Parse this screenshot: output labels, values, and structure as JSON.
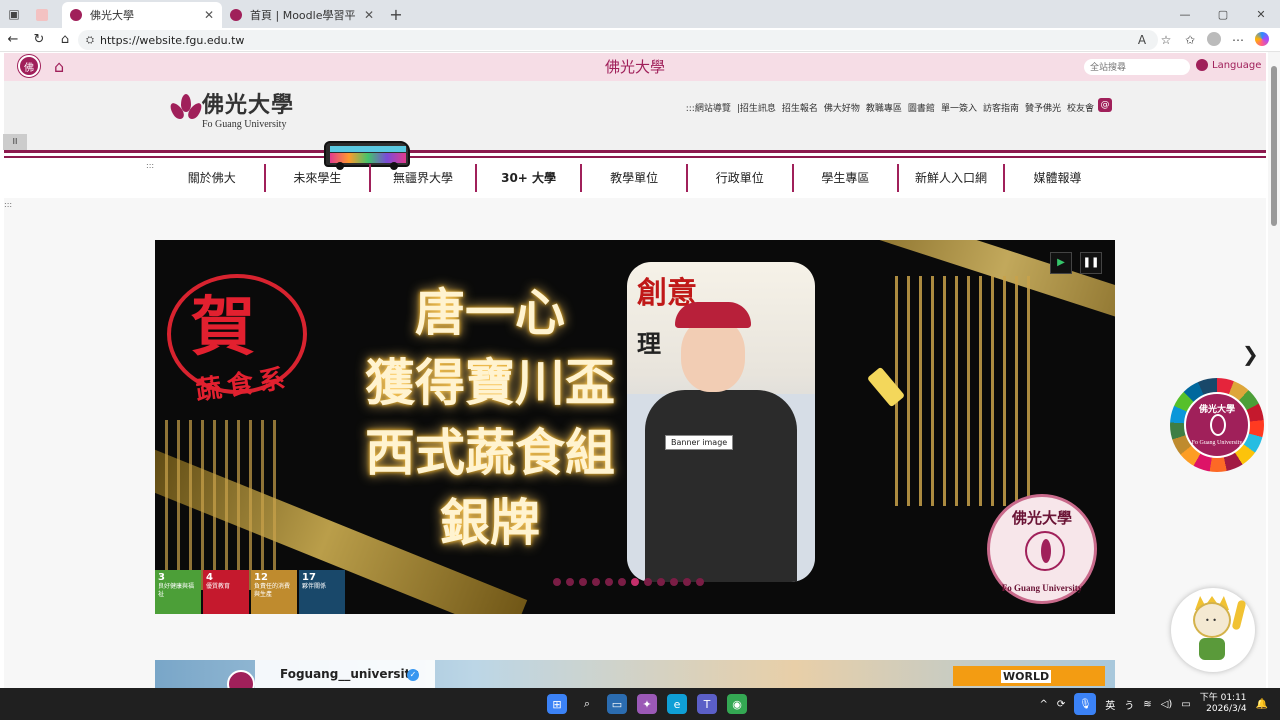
{
  "browser": {
    "tabs": [
      {
        "label": "",
        "favicon": "pdf-icon",
        "active": false
      },
      {
        "label": "佛光大學",
        "favicon": "fgu-logo-icon",
        "active": true
      },
      {
        "label": "首頁 | Moodle學習平臺",
        "favicon": "moodle-icon",
        "active": false
      }
    ],
    "new_tab_glyph": "+",
    "url": "https://website.fgu.edu.tw",
    "window_controls": [
      "—",
      "▢",
      "✕"
    ]
  },
  "topbar": {
    "site_title": "佛光大學",
    "search_placeholder": "全站搜尋",
    "language_label": "Language"
  },
  "header": {
    "brand_zh": "佛光大學",
    "brand_en": "Fo Guang University",
    "quick_links": [
      ":::網站導覽",
      "|招生訊息",
      "招生報名",
      "佛大好物",
      "教職專區",
      "圖書館",
      "單一簽入",
      "訪客指南",
      "贊予佛光",
      "校友會"
    ],
    "pause_label": "II",
    "accent_color": "#a0205a"
  },
  "main_nav": [
    {
      "label": "關於佛大",
      "bold": false
    },
    {
      "label": "未來學生",
      "bold": false
    },
    {
      "label": "無疆界大學",
      "bold": false
    },
    {
      "label": "30+ 大學",
      "bold": true
    },
    {
      "label": "教學單位",
      "bold": false
    },
    {
      "label": "行政單位",
      "bold": false
    },
    {
      "label": "學生專區",
      "bold": false
    },
    {
      "label": "新鮮人入口網",
      "bold": false
    },
    {
      "label": "媒體報導",
      "bold": false
    }
  ],
  "banner": {
    "stamp_main": "賀",
    "stamp_sub": "蔬食系",
    "headline_lines": [
      "唐一心",
      "獲得寶川盃",
      "西式蔬食組",
      "銀牌"
    ],
    "photo_sign_1": "創意",
    "photo_sign_2": "理",
    "tooltip": "Banner image",
    "seal_zh": "佛光大學",
    "seal_en": "Fo Guang University",
    "sdg_tiles": [
      {
        "number": "3",
        "label": "良好健康與福祉",
        "color": "#4c9f38"
      },
      {
        "number": "4",
        "label": "優質教育",
        "color": "#c5192d"
      },
      {
        "number": "12",
        "label": "負責任的消費與生產",
        "color": "#bf8b2e"
      },
      {
        "number": "17",
        "label": "夥伴關係",
        "color": "#19486a"
      }
    ],
    "slide_count": 12,
    "active_slide": 6
  },
  "sdg_badge": {
    "zh": "佛光大學",
    "en": "Fo Guang University"
  },
  "instagram": {
    "account": "Foguang__university",
    "tag": "WORLD"
  },
  "taskbar": {
    "ime": "英",
    "time": "下午 01:11",
    "date": "2026/3/4"
  }
}
